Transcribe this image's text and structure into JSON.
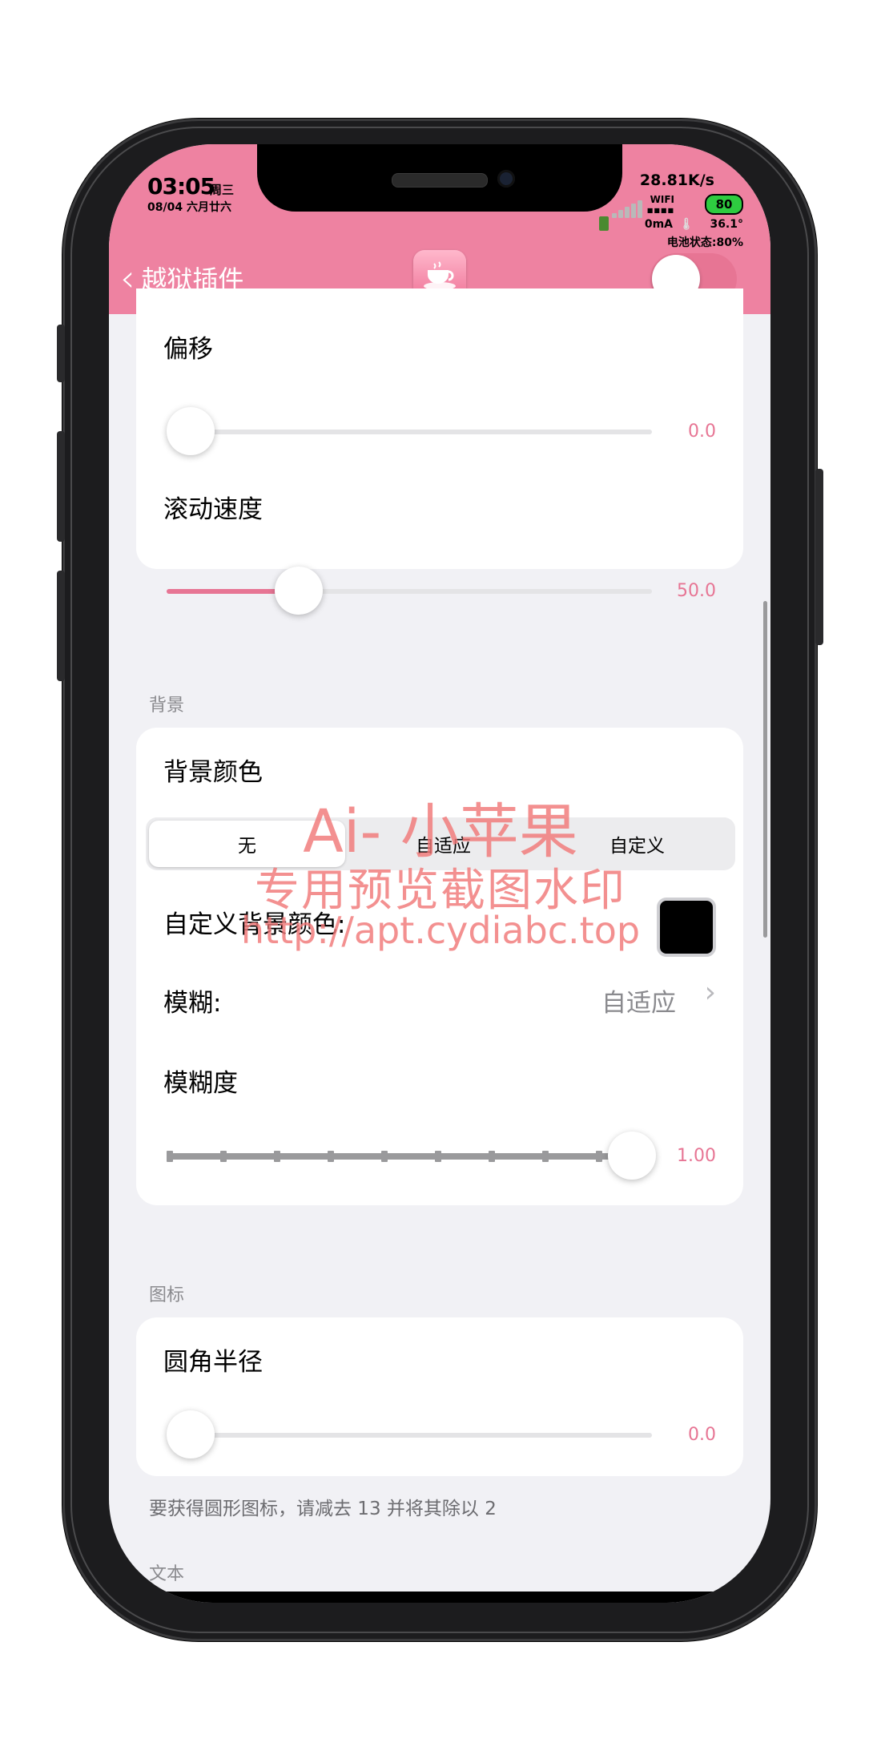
{
  "status_bar": {
    "time": "03:05",
    "weekday": "周三",
    "date": "08/04 六月廿六",
    "net_speed": "28.81K/s",
    "wifi": "WIFI",
    "battery_level": "80",
    "current": "0mA",
    "temperature": "36.1°",
    "battery_status": "电池状态:80%"
  },
  "nav": {
    "back_label": "越狱插件",
    "app_icon": "teacup-icon",
    "toggle_on": false
  },
  "sections": {
    "offset": {
      "label": "偏移",
      "value_text": "0.0",
      "value": 0
    },
    "scroll_speed": {
      "label": "滚动速度",
      "value_text": "50.0",
      "value": 50
    },
    "background_header": "背景",
    "bg_color": {
      "label": "背景颜色",
      "options": [
        "无",
        "自适应",
        "自定义"
      ],
      "selected": "无"
    },
    "custom_bg_color": {
      "label": "自定义背景颜色:",
      "color": "#000000"
    },
    "blur": {
      "label": "模糊:",
      "value": "自适应"
    },
    "blur_amount": {
      "label": "模糊度",
      "value_text": "1.00",
      "value": 1.0,
      "steps": 9
    },
    "icon_header": "图标",
    "corner_radius": {
      "label": "圆角半径",
      "value_text": "0.0",
      "value": 0
    },
    "corner_footnote": "要获得圆形图标，请减去 13 并将其除以 2",
    "text_header": "文本"
  },
  "watermark": {
    "line1": "Ai- 小苹果",
    "line2": "专用预览截图水印",
    "line3": "http://apt.cydiabc.top"
  },
  "colors": {
    "accent": "#e77594",
    "header": "#ee82a1",
    "background": "#f1f1f5"
  }
}
